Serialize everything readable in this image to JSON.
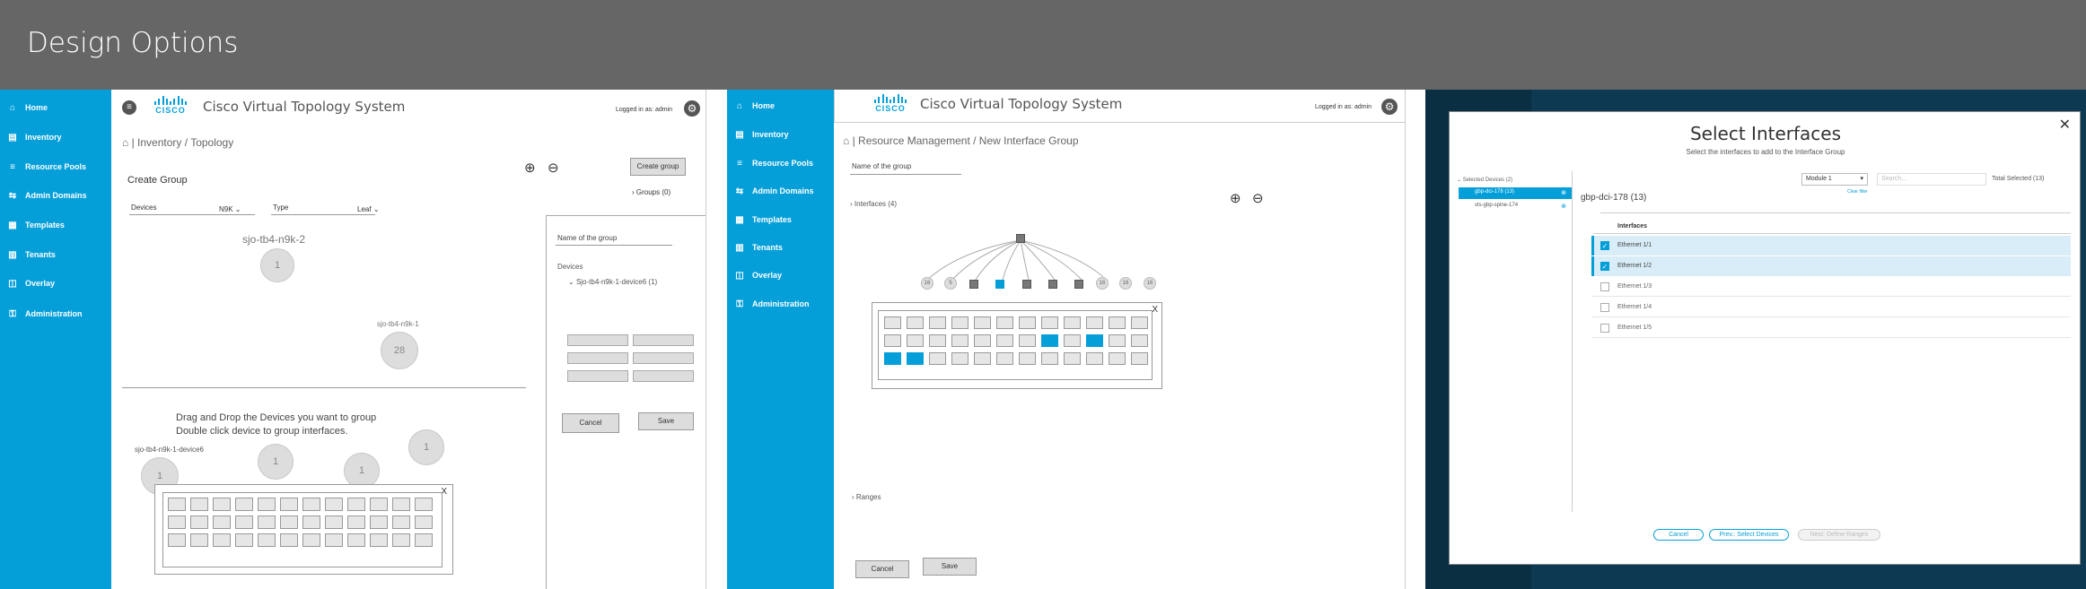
{
  "page": {
    "title": "Design Options"
  },
  "brand": {
    "product": "Cisco Virtual Topology System",
    "logo_text": "CISCO",
    "accent": "#049fd9"
  },
  "sidebar": {
    "items": [
      {
        "label": "Home",
        "icon": "home-icon"
      },
      {
        "label": "Inventory",
        "icon": "inventory-icon"
      },
      {
        "label": "Resource Pools",
        "icon": "database-icon"
      },
      {
        "label": "Admin Domains",
        "icon": "admin-domains-icon"
      },
      {
        "label": "Templates",
        "icon": "templates-icon"
      },
      {
        "label": "Tenants",
        "icon": "tenants-icon"
      },
      {
        "label": "Overlay",
        "icon": "overlay-icon"
      },
      {
        "label": "Administration",
        "icon": "administration-icon"
      }
    ]
  },
  "header": {
    "logged_in": "Logged in as: admin"
  },
  "screen1": {
    "breadcrumb": "Inventory / Topology",
    "create_group_btn": "Create group",
    "groups_link": "Groups (0)",
    "create_group_title": "Create Group",
    "devices_label": "Devices",
    "devices_value": "N9K",
    "type_label": "Type",
    "type_value": "Leaf",
    "node1_label": "sjo-tb4-n9k-2",
    "node1_count": "1",
    "node2_label": "sjo-tb4-n9k-1",
    "node2_count": "28",
    "instructions_line1": "Drag and Drop the Devices you want to group",
    "instructions_line2": "Double click device to group interfaces.",
    "device6_label": "sjo-tb4-n9k-1-device6",
    "bubble_a": "1",
    "bubble_b": "1",
    "bubble_c": "1",
    "bubble_d": "1",
    "close_x": "X",
    "group_name_placeholder": "Name of the group",
    "devices_section": "Devices",
    "device_tree_item": "Sjo-tb4-n9k-1-device6 (1)",
    "cancel": "Cancel",
    "save": "Save"
  },
  "screen2": {
    "breadcrumb": "Resource Management / New Interface Group",
    "group_name_placeholder": "Name of the group",
    "interfaces_toggle": "Interfaces (4)",
    "ranges_toggle": "Ranges",
    "close_x": "X",
    "node_labels": [
      "16",
      "5",
      "16",
      "16",
      "16"
    ],
    "cancel": "Cancel",
    "save": "Save"
  },
  "screen3": {
    "dialog_title": "Select Interfaces",
    "dialog_subtitle": "Select the interfaces to add to the Interface Group",
    "selected_devices": "Selected Devices (2)",
    "device_1": "gbp-dci-178 (13)",
    "device_2": "vts-gbp-spine-174",
    "module_select": "Module 1",
    "search_placeholder": "Search...",
    "total_selected": "Total Selected (13)",
    "clear_filter": "Clear filter",
    "device_heading": "gbp-dci-178 (13)",
    "column_interfaces": "Interfaces",
    "interfaces": [
      {
        "name": "Ethernet 1/1",
        "checked": true
      },
      {
        "name": "Ethernet 1/2",
        "checked": true
      },
      {
        "name": "Ethernet 1/3",
        "checked": false
      },
      {
        "name": "Ethernet 1/4",
        "checked": false
      },
      {
        "name": "Ethernet 1/5",
        "checked": false
      }
    ],
    "cancel": "Cancel",
    "prev": "Prev.: Select Devices",
    "next": "Next: Define Ranges",
    "close_x": "✕"
  }
}
